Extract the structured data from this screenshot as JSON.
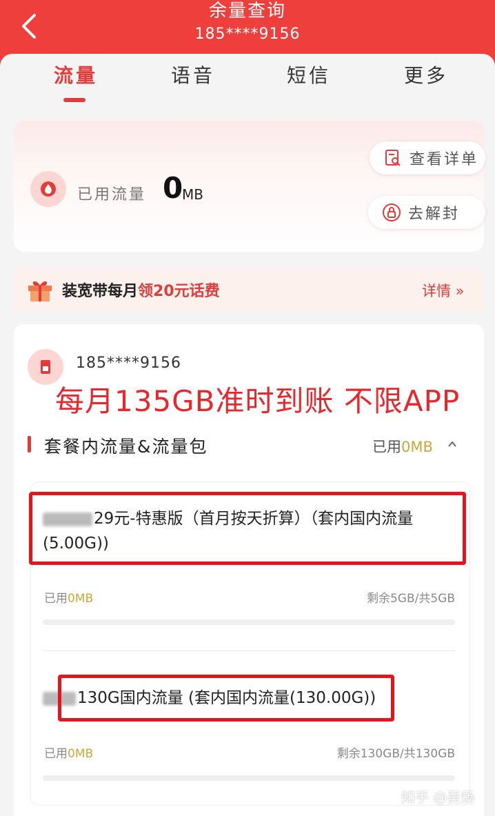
{
  "header": {
    "title": "余量查询",
    "subtitle": "185****9156"
  },
  "tabs": [
    {
      "label": "流量",
      "active": true
    },
    {
      "label": "语音",
      "active": false
    },
    {
      "label": "短信",
      "active": false
    },
    {
      "label": "更多",
      "active": false
    }
  ],
  "usage": {
    "label": "已用流量",
    "value": "0",
    "unit": "MB",
    "detail_button": "查看详单",
    "unlock_button": "去解封"
  },
  "promo": {
    "text_prefix": "装宽带每月",
    "text_highlight": "领20元话费",
    "more_label": "详情 »"
  },
  "package": {
    "phone_number": "185****9156",
    "overlay_caption": "每月135GB准时到账 不限APP",
    "section_title": "套餐内流量&流量包",
    "section_used_label": "已用",
    "section_used_value": "0MB",
    "items": [
      {
        "name": "29元-特惠版（首月按天折算）（套内国内流量(5.00G))",
        "used_label": "已用",
        "used_value": "0MB",
        "remain": "剩余5GB/共5GB",
        "progress": 0
      },
      {
        "name": "130G国内流量 (套内国内流量(130.00G))",
        "used_label": "已用",
        "used_value": "0MB",
        "remain": "剩余130GB/共130GB",
        "progress": 0
      }
    ]
  },
  "watermark": "知乎 @吴炀",
  "colors": {
    "header_red": "#ef3f3c",
    "accent_red": "#e23c3a",
    "annotation_red": "#e2161b",
    "gold": "#c7a83b"
  }
}
